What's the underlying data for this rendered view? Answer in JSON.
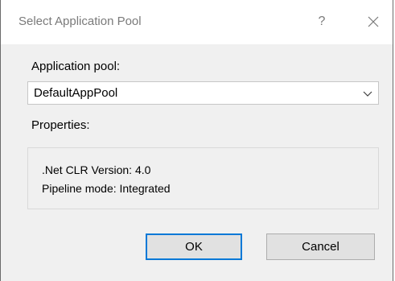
{
  "dialog": {
    "title": "Select Application Pool",
    "help_label": "?",
    "close_icon": "close-icon"
  },
  "pool": {
    "label": "Application pool:",
    "selected": "DefaultAppPool",
    "dropdown_icon": "chevron-down-icon"
  },
  "properties": {
    "label": "Properties:",
    "clr_version": ".Net CLR Version: 4.0",
    "pipeline_mode": "Pipeline mode: Integrated"
  },
  "buttons": {
    "ok": "OK",
    "cancel": "Cancel"
  },
  "colors": {
    "dialog_bg": "#f0f0f0",
    "titlebar_bg": "#ffffff",
    "focus_border": "#0078d7"
  }
}
